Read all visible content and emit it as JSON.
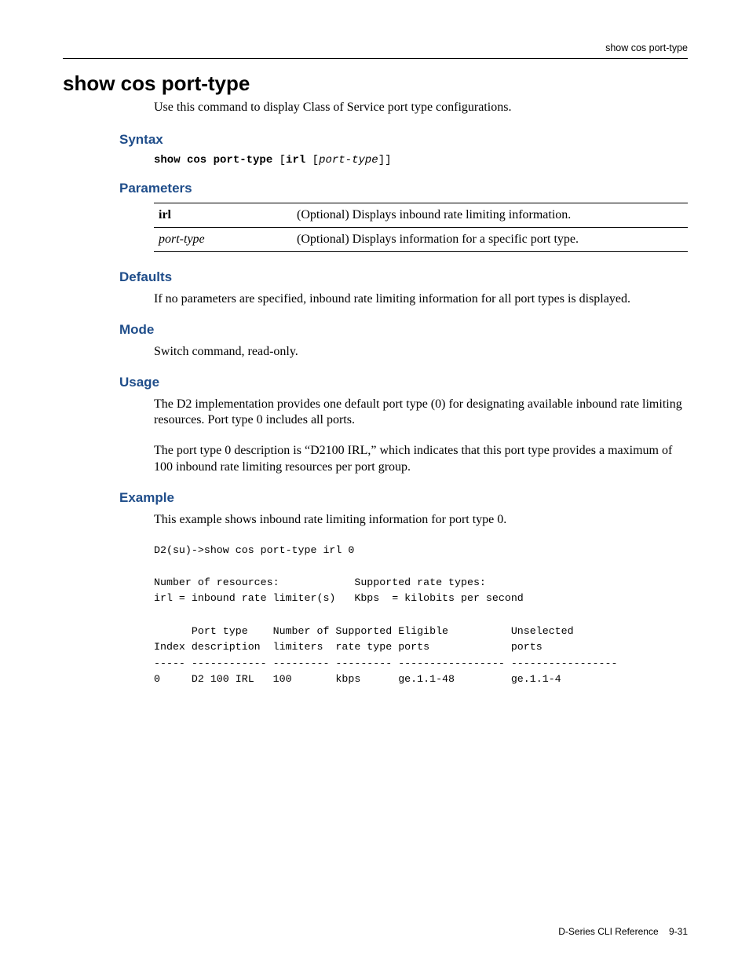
{
  "header": {
    "running_title": "show cos port-type"
  },
  "title": "show cos port-type",
  "intro": "Use this command to display Class of Service port type configurations.",
  "sections": {
    "syntax": {
      "heading": "Syntax",
      "cmd_bold1": "show cos port-type",
      "cmd_plain1": " [",
      "cmd_bold2": "irl",
      "cmd_plain2": " [",
      "cmd_ital": "port-type",
      "cmd_plain3": "]]"
    },
    "parameters": {
      "heading": "Parameters",
      "rows": [
        {
          "name": "irl",
          "italic": false,
          "desc": "(Optional) Displays inbound rate limiting information."
        },
        {
          "name": "port-type",
          "italic": true,
          "desc": "(Optional) Displays information for a specific port type."
        }
      ]
    },
    "defaults": {
      "heading": "Defaults",
      "text": "If no parameters are specified, inbound rate limiting information for all port types is displayed."
    },
    "mode": {
      "heading": "Mode",
      "text": "Switch command, read-only."
    },
    "usage": {
      "heading": "Usage",
      "p1": "The  D2 implementation provides one default port type (0) for designating available inbound rate limiting resources. Port type 0 includes all ports.",
      "p2": "The port type 0 description is “D2100 IRL,” which indicates that this port type provides a maximum of 100 inbound rate limiting resources per port group."
    },
    "example": {
      "heading": "Example",
      "intro": "This example shows inbound rate limiting information for port type 0.",
      "output": "D2(su)->show cos port-type irl 0\n\nNumber of resources:            Supported rate types:\nirl = inbound rate limiter(s)   Kbps  = kilobits per second\n\n      Port type    Number of Supported Eligible          Unselected\nIndex description  limiters  rate type ports             ports\n----- ------------ --------- --------- ----------------- -----------------\n0     D2 100 IRL   100       kbps      ge.1.1-48         ge.1.1-4"
    }
  },
  "footer": {
    "doc": "D-Series CLI Reference",
    "page": "9-31"
  }
}
